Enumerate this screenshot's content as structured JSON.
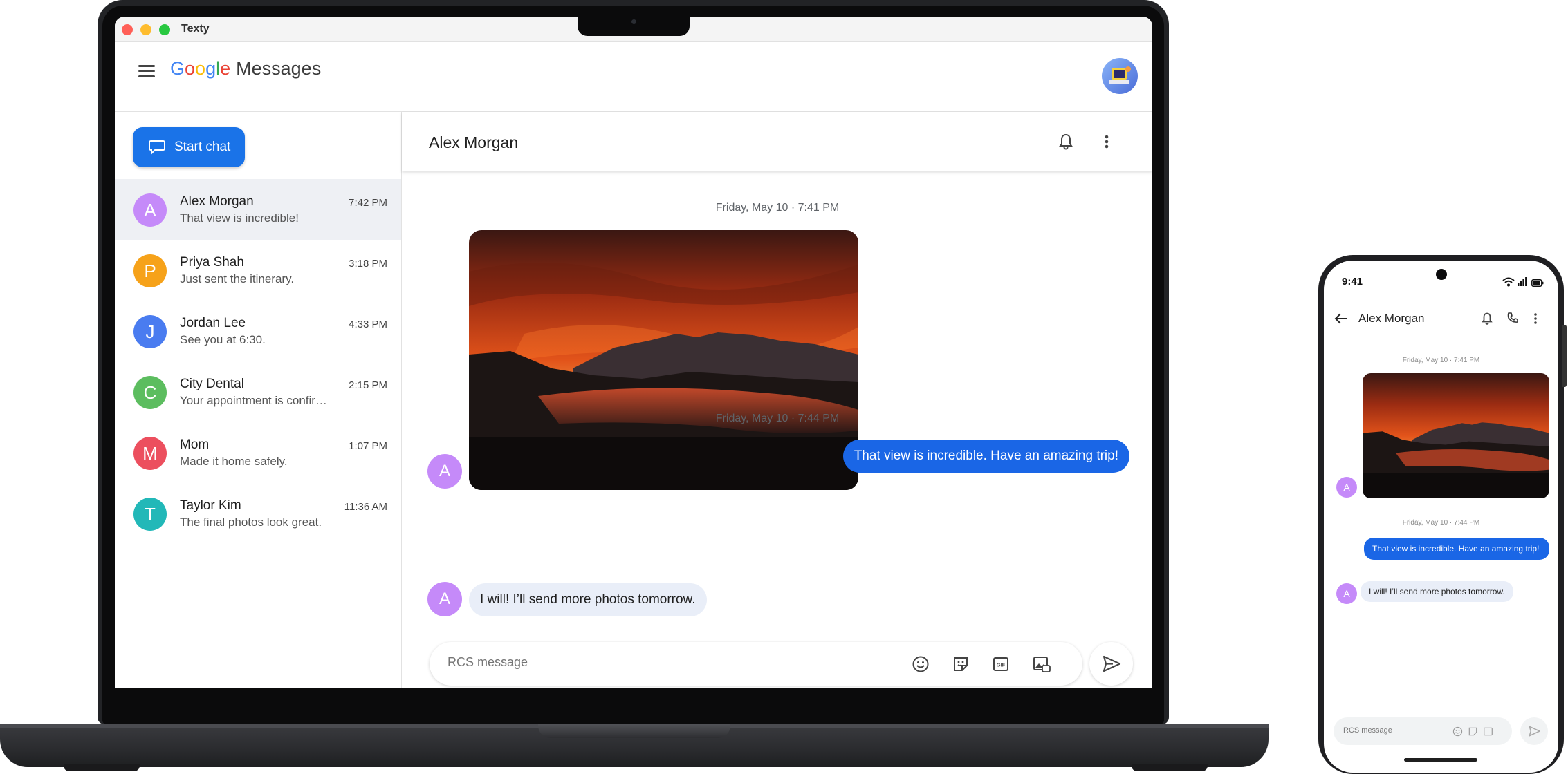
{
  "window": {
    "title": "Texty"
  },
  "app": {
    "logo_google": [
      "G",
      "o",
      "o",
      "g",
      "l",
      "e"
    ],
    "logo_messages": "Messages",
    "start_chat_label": "Start chat"
  },
  "conversations": [
    {
      "initial": "A",
      "name": "Alex Morgan",
      "snippet": "That view is incredible!",
      "time": "7:42 PM",
      "color": "#c58af9",
      "active": true
    },
    {
      "initial": "P",
      "name": "Priya Shah",
      "snippet": "Just sent the itinerary.",
      "time": "3:18 PM",
      "color": "#f6a21a"
    },
    {
      "initial": "J",
      "name": "Jordan Lee",
      "snippet": "See you at 6:30.",
      "time": "4:33 PM",
      "color": "#4a7cf0"
    },
    {
      "initial": "C",
      "name": "City Dental",
      "snippet": "Your appointment is confir…",
      "time": "2:15 PM",
      "color": "#5cbd5f"
    },
    {
      "initial": "M",
      "name": "Mom",
      "snippet": "Made it home safely.",
      "time": "1:07 PM",
      "color": "#ec4f5e"
    },
    {
      "initial": "T",
      "name": "Taylor Kim",
      "snippet": "The final photos look great.",
      "time": "11:36 AM",
      "color": "#22b8b8"
    }
  ],
  "chat": {
    "contact_name": "Alex Morgan",
    "contact_initial": "A",
    "stamp_1": "Friday, May 10 · 7:41 PM",
    "stamp_2": "Friday, May 10 · 7:44 PM",
    "outgoing_1": "That view is incredible. Have an amazing trip!",
    "incoming_1": "I will! I’ll send more photos tomorrow.",
    "composer_placeholder": "RCS message",
    "composer_icons": [
      "emoji-icon",
      "sticker-icon",
      "gif-icon",
      "gallery-icon"
    ]
  },
  "phone": {
    "status_time": "9:41",
    "contact_name": "Alex Morgan",
    "contact_initial": "A",
    "stamp_1": "Friday, May 10 · 7:41 PM",
    "stamp_2": "Friday, May 10 · 7:44 PM",
    "outgoing_1": "That view is incredible. Have an amazing trip!",
    "incoming_1": "I will! I’ll send more photos tomorrow.",
    "composer_placeholder": "RCS message"
  },
  "colors": {
    "accent": "#1a73e8",
    "outgoing_bubble": "#1a66e6",
    "incoming_bubble": "#e9eef8",
    "google_blue": "#4285f4",
    "google_red": "#ea4335",
    "google_yellow": "#fbbc05",
    "google_green": "#34a853"
  }
}
